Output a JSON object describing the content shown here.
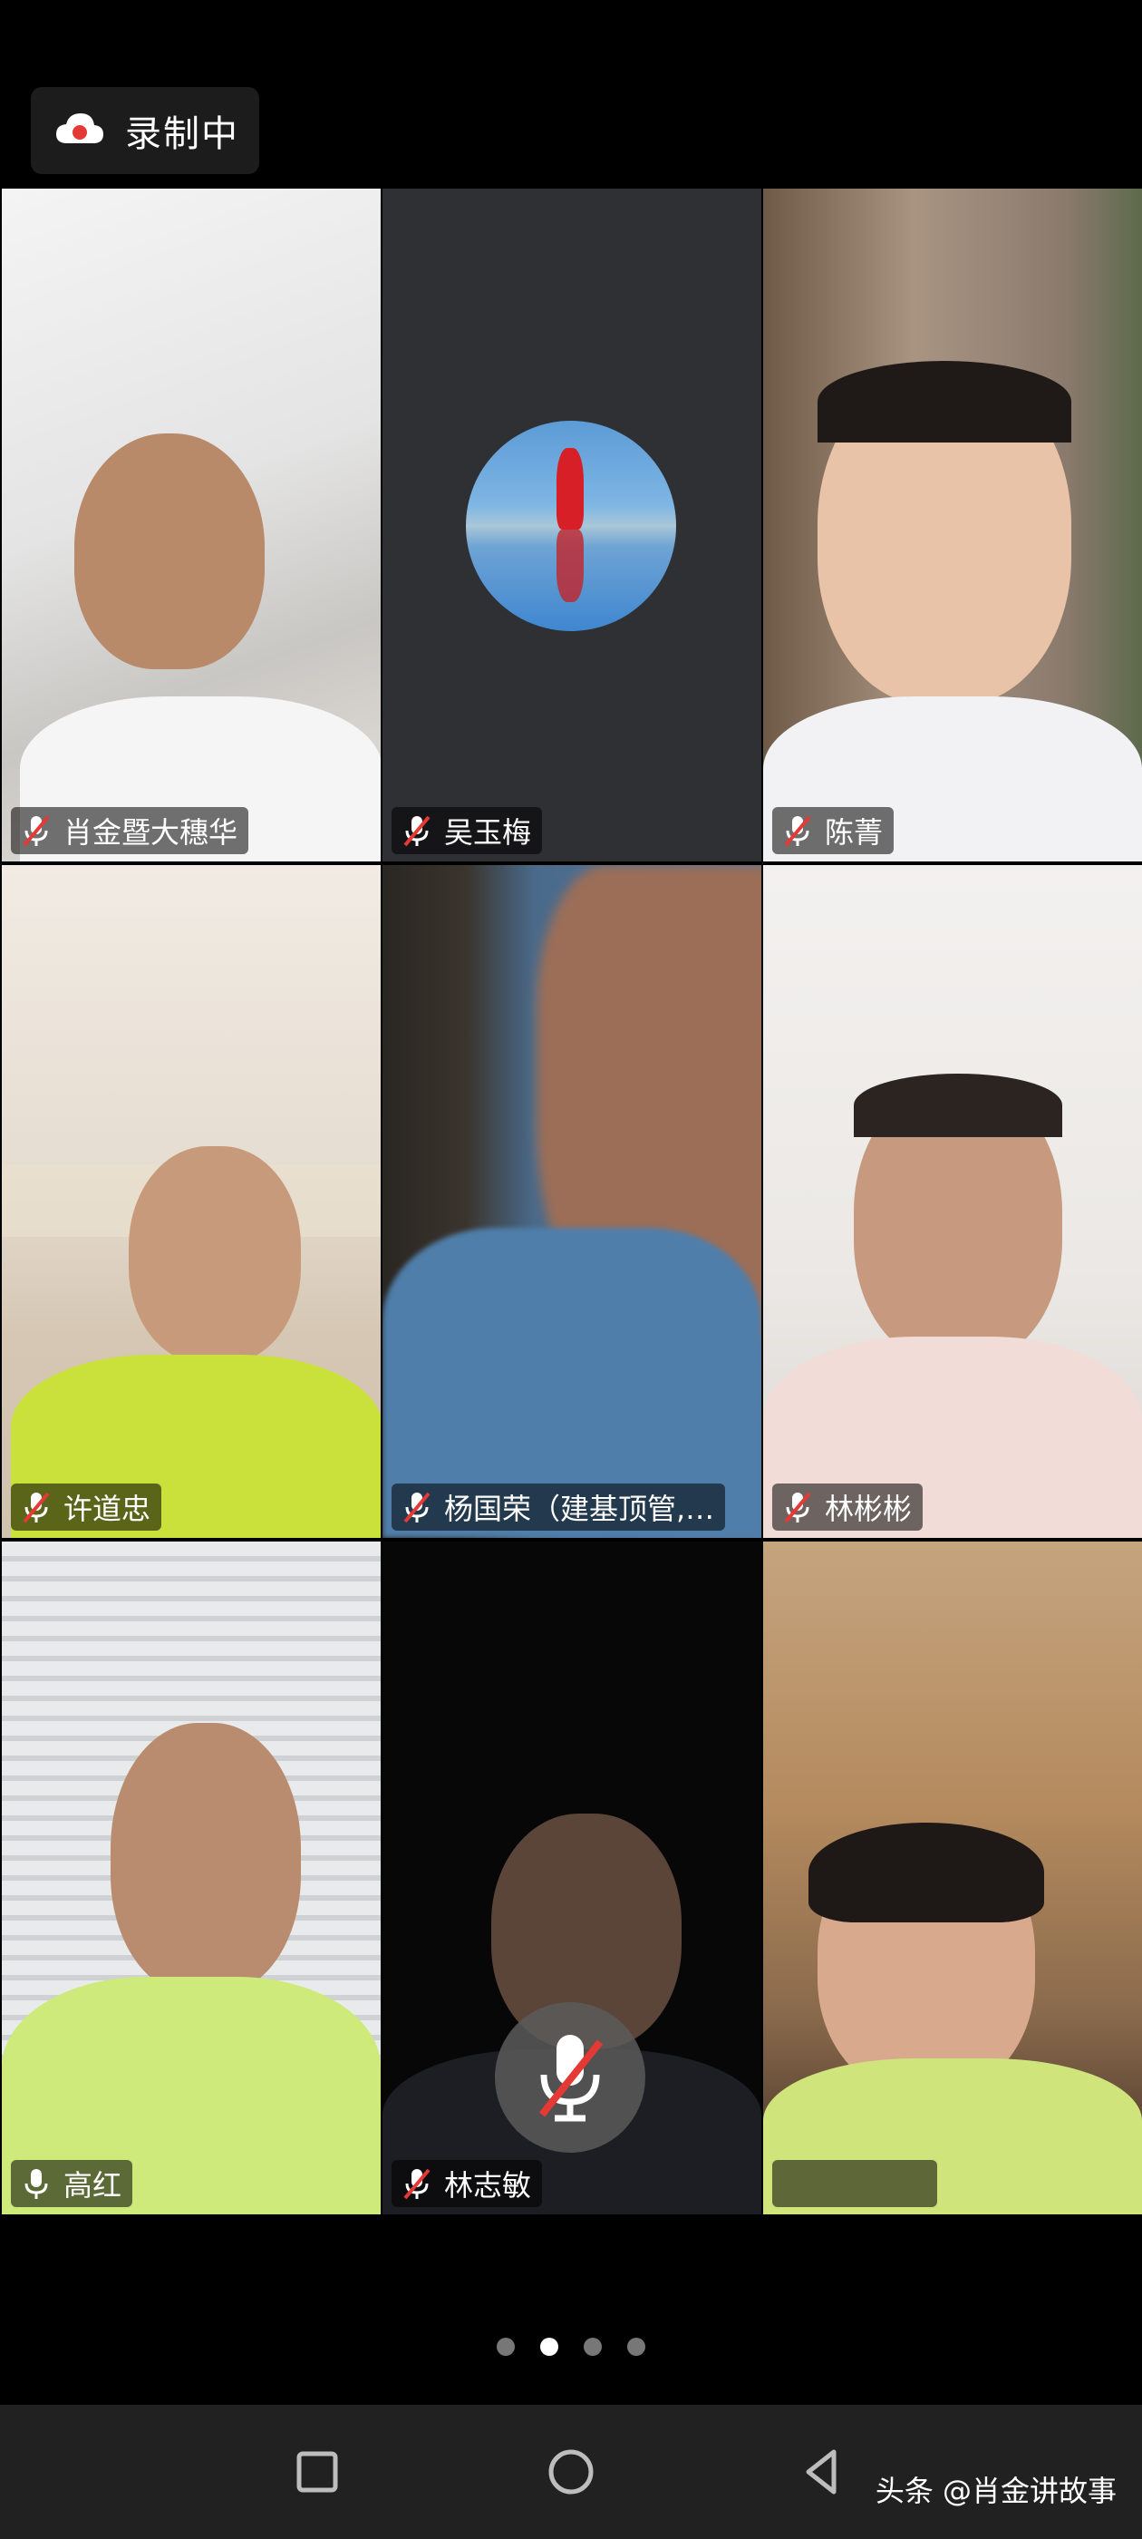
{
  "recording": {
    "label": "录制中"
  },
  "participants": [
    {
      "name": "肖金暨大穗华",
      "mic": "muted"
    },
    {
      "name": "吴玉梅",
      "mic": "muted"
    },
    {
      "name": "陈菁",
      "mic": "muted"
    },
    {
      "name": "许道忠",
      "mic": "muted"
    },
    {
      "name": "杨国荣（建基顶管,…",
      "mic": "muted"
    },
    {
      "name": "林彬彬",
      "mic": "muted"
    },
    {
      "name": "高红",
      "mic": "active"
    },
    {
      "name": "林志敏",
      "mic": "muted"
    },
    {
      "name": "",
      "mic": "none"
    }
  ],
  "pager": {
    "total": 4,
    "current": 2
  },
  "watermark": "头条 @肖金讲故事",
  "colors": {
    "background": "#000000",
    "navbar": "#212121",
    "chip": "rgba(0,0,0,0.55)",
    "muted_mic": "#e53935"
  }
}
